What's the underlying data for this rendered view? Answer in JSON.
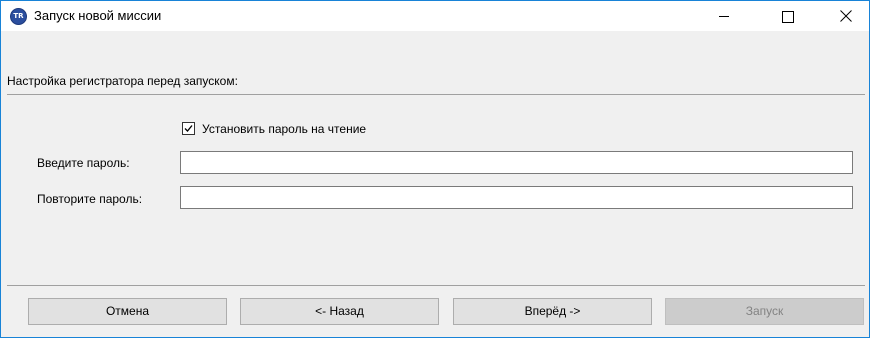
{
  "window": {
    "title": "Запуск новой миссии",
    "icon_text": "TR",
    "controls": [
      "minimize-icon",
      "maximize-icon",
      "close-icon"
    ]
  },
  "section": {
    "header": "Настройка регистратора перед запуском:"
  },
  "password": {
    "checkbox_label": "Установить пароль на чтение",
    "checkbox_checked": true,
    "enter_label": "Введите пароль:",
    "enter_value": "",
    "repeat_label": "Повторите пароль:",
    "repeat_value": ""
  },
  "buttons": {
    "cancel": "Отмена",
    "back": "<- Назад",
    "next": "Вперёд ->",
    "launch": "Запуск",
    "launch_enabled": false
  },
  "colors": {
    "window_border": "#1883d7",
    "window_bg": "#f0f0f0",
    "button_bg": "#e1e1e1",
    "disabled_text": "#838383"
  }
}
